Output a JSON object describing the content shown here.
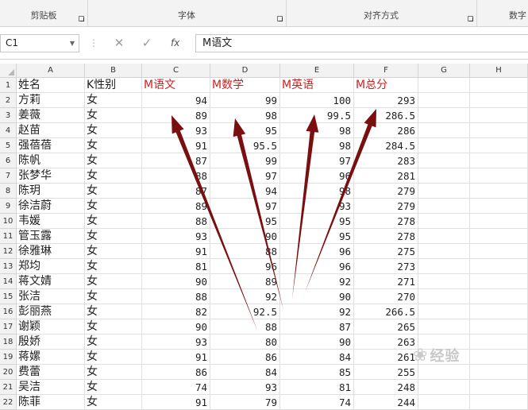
{
  "ribbon": {
    "groups": [
      {
        "label": "剪贴板"
      },
      {
        "label": "字体"
      },
      {
        "label": "对齐方式"
      },
      {
        "label": "数字"
      }
    ]
  },
  "formula_bar": {
    "name_box": "C1",
    "cancel_symbol": "✕",
    "enter_symbol": "✓",
    "fx_label": "fx",
    "content": "M语文"
  },
  "columns": [
    "A",
    "B",
    "C",
    "D",
    "E",
    "F",
    "G",
    "H"
  ],
  "rows": [
    {
      "n": "1",
      "name": "姓名",
      "sex": "K性别",
      "c": "M语文",
      "d": "M数学",
      "e": "M英语",
      "f": "M总分"
    },
    {
      "n": "2",
      "name": "方莉",
      "sex": "女",
      "c": "94",
      "d": "99",
      "e": "100",
      "f": "293"
    },
    {
      "n": "3",
      "name": "姜薇",
      "sex": "女",
      "c": "89",
      "d": "98",
      "e": "99.5",
      "f": "286.5"
    },
    {
      "n": "4",
      "name": "赵苗",
      "sex": "女",
      "c": "93",
      "d": "95",
      "e": "98",
      "f": "286"
    },
    {
      "n": "5",
      "name": "强蓓蓓",
      "sex": "女",
      "c": "91",
      "d": "95.5",
      "e": "98",
      "f": "284.5"
    },
    {
      "n": "6",
      "name": "陈帆",
      "sex": "女",
      "c": "87",
      "d": "99",
      "e": "97",
      "f": "283"
    },
    {
      "n": "7",
      "name": "张梦华",
      "sex": "女",
      "c": "88",
      "d": "97",
      "e": "96",
      "f": "281"
    },
    {
      "n": "8",
      "name": "陈玥",
      "sex": "女",
      "c": "87",
      "d": "94",
      "e": "98",
      "f": "279"
    },
    {
      "n": "9",
      "name": "徐洁蔚",
      "sex": "女",
      "c": "89",
      "d": "97",
      "e": "93",
      "f": "279"
    },
    {
      "n": "10",
      "name": "韦媛",
      "sex": "女",
      "c": "88",
      "d": "95",
      "e": "95",
      "f": "278"
    },
    {
      "n": "11",
      "name": "管玉露",
      "sex": "女",
      "c": "93",
      "d": "90",
      "e": "95",
      "f": "278"
    },
    {
      "n": "12",
      "name": "徐雅琳",
      "sex": "女",
      "c": "91",
      "d": "88",
      "e": "96",
      "f": "275"
    },
    {
      "n": "13",
      "name": "郑均",
      "sex": "女",
      "c": "81",
      "d": "96",
      "e": "96",
      "f": "273"
    },
    {
      "n": "14",
      "name": "蒋文婧",
      "sex": "女",
      "c": "90",
      "d": "89",
      "e": "92",
      "f": "271"
    },
    {
      "n": "15",
      "name": "张洁",
      "sex": "女",
      "c": "88",
      "d": "92",
      "e": "90",
      "f": "270"
    },
    {
      "n": "16",
      "name": "彭丽燕",
      "sex": "女",
      "c": "82",
      "d": "92.5",
      "e": "92",
      "f": "266.5"
    },
    {
      "n": "17",
      "name": "谢颖",
      "sex": "女",
      "c": "90",
      "d": "88",
      "e": "87",
      "f": "265"
    },
    {
      "n": "18",
      "name": "殷娇",
      "sex": "女",
      "c": "93",
      "d": "80",
      "e": "90",
      "f": "263"
    },
    {
      "n": "19",
      "name": "蒋嫘",
      "sex": "女",
      "c": "91",
      "d": "86",
      "e": "84",
      "f": "261"
    },
    {
      "n": "20",
      "name": "费蕾",
      "sex": "女",
      "c": "86",
      "d": "84",
      "e": "85",
      "f": "255"
    },
    {
      "n": "21",
      "name": "吴洁",
      "sex": "女",
      "c": "74",
      "d": "93",
      "e": "81",
      "f": "248"
    },
    {
      "n": "22",
      "name": "陈菲",
      "sex": "女",
      "c": "91",
      "d": "79",
      "e": "74",
      "f": "244"
    }
  ],
  "colors": {
    "header_text": "#d12020",
    "arrow": "#7a0f0f",
    "grid": "#e0e0e0",
    "header_bg": "#f2f2f2"
  },
  "watermark": {
    "text": "经验"
  }
}
